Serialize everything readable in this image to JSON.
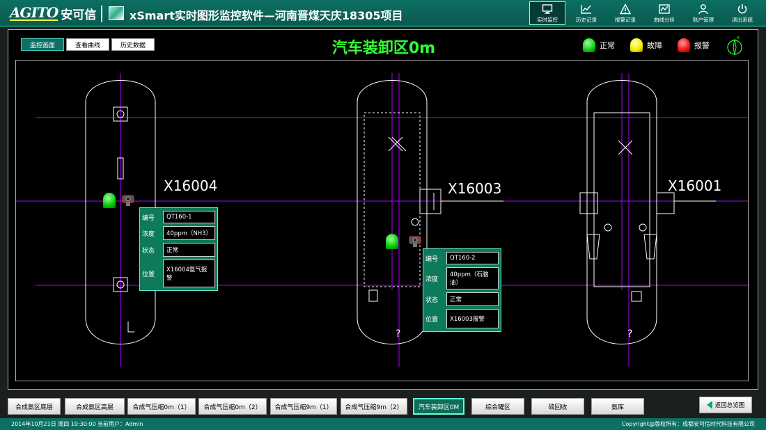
{
  "header": {
    "logo_mark": "AGITO",
    "logo_cn": "安可信",
    "title": "xSmart实时图形监控软件—河南晋煤天庆18305项目",
    "nav": [
      {
        "id": "realtime",
        "label": "实时监控",
        "icon": "monitor-icon",
        "active": true
      },
      {
        "id": "history",
        "label": "历史记录",
        "icon": "chart-line-icon",
        "active": false
      },
      {
        "id": "alarm",
        "label": "报警记录",
        "icon": "warning-icon",
        "active": false
      },
      {
        "id": "curve",
        "label": "曲线分析",
        "icon": "curve-icon",
        "active": false
      },
      {
        "id": "account",
        "label": "账户管理",
        "icon": "user-icon",
        "active": false
      },
      {
        "id": "exit",
        "label": "退出系统",
        "icon": "power-icon",
        "active": false
      }
    ]
  },
  "tabs": [
    {
      "label": "监控画面",
      "active": true
    },
    {
      "label": "查看曲线",
      "active": false
    },
    {
      "label": "历史数据",
      "active": false
    }
  ],
  "area_title": "汽车装卸区0m",
  "legend": {
    "normal": {
      "label": "正常",
      "color": "#22cc22"
    },
    "fault": {
      "label": "故障",
      "color": "#f2e20a"
    },
    "alarm": {
      "label": "报警",
      "color": "#e21010"
    }
  },
  "tanks": {
    "t1": "X16004",
    "t2": "X16003",
    "t3": "X16001"
  },
  "detectors": {
    "d1": {
      "labels": {
        "id": "编号",
        "conc": "浓度",
        "state": "状态",
        "loc": "位置"
      },
      "id": "QT160-1",
      "conc": "40ppm（NH3）",
      "state": "正常",
      "loc": "X16004氨气报警"
    },
    "d2": {
      "labels": {
        "id": "编号",
        "conc": "浓度",
        "state": "状态",
        "loc": "位置"
      },
      "id": "QT160-2",
      "conc": "40ppm（石脑油）",
      "state": "正常",
      "loc": "X16003报警"
    }
  },
  "area_buttons": [
    {
      "label": "合成氨区底层",
      "active": false
    },
    {
      "label": "合成氨区高层",
      "active": false
    },
    {
      "label": "合成气压缩0m（1）",
      "active": false
    },
    {
      "label": "合成气压缩0m（2）",
      "active": false
    },
    {
      "label": "合成气压缩9m（1）",
      "active": false
    },
    {
      "label": "合成气压缩9m（2）",
      "active": false
    },
    {
      "label": "汽车装卸区0M",
      "active": true
    },
    {
      "label": "综合罐区",
      "active": false
    },
    {
      "label": "硫回收",
      "active": false
    },
    {
      "label": "氨库",
      "active": false
    }
  ],
  "back_button": "返回总览图",
  "status": {
    "datetime": "2014年10月21日 周四  10:30:00",
    "user": "当前用户：Admin",
    "copyright": "Copyright@版权所有：成都安可信时代科技有限公司"
  }
}
